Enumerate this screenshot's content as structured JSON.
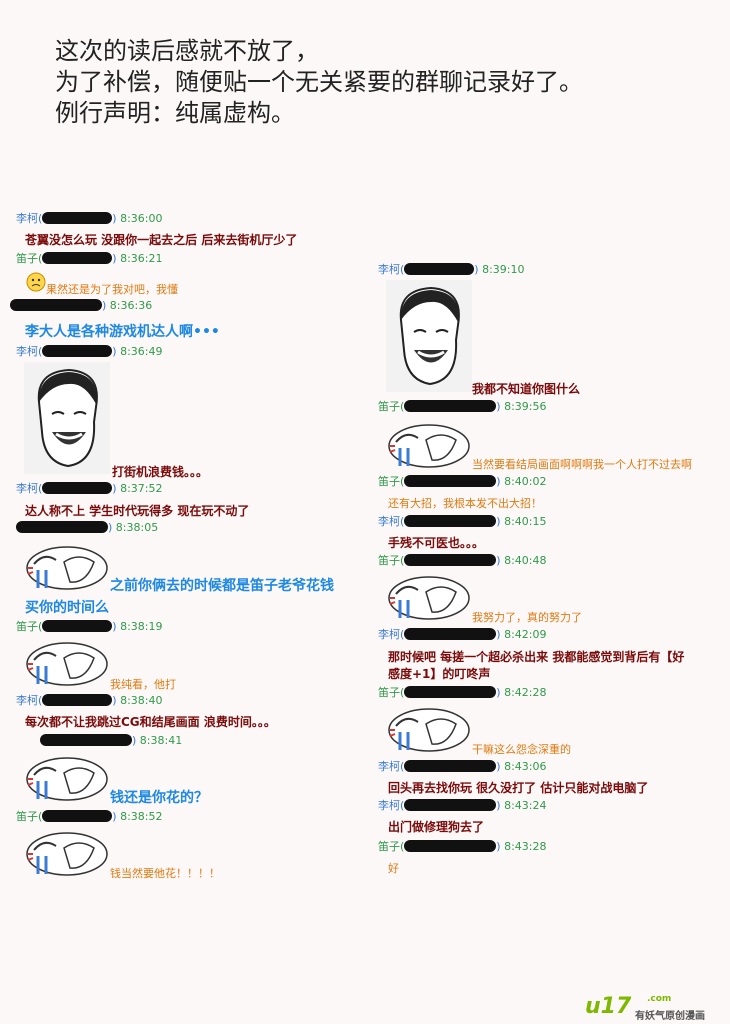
{
  "intro": [
    "这次的读后感就不放了，",
    "为了补偿，随便贴一个无关紧要的群聊记录好了。",
    "例行声明：纯属虚构。"
  ],
  "names": {
    "li": "李柯(",
    "di": "笛子(",
    "close": ")"
  },
  "left": {
    "m1": {
      "time": "8:36:00",
      "text": "苍翼没怎么玩 没跟你一起去之后 后来去街机厅少了"
    },
    "m2": {
      "time": "8:36:21",
      "text": "果然还是为了我对吧，我懂"
    },
    "m3": {
      "time": "8:36:36",
      "text": "李大人是各种游戏机达人啊•••"
    },
    "m4": {
      "time": "8:36:49",
      "text": "打街机浪费钱。。。"
    },
    "m5": {
      "time": "8:37:52",
      "text": "达人称不上 学生时代玩得多 现在玩不动了"
    },
    "m6": {
      "time": "8:38:05",
      "text1": "之前你俩去的时候都是笛子老爷花钱",
      "text2": "买你的时间么"
    },
    "m7": {
      "time": "8:38:19",
      "text": "我纯看，他打"
    },
    "m8": {
      "time": "8:38:40",
      "text": "每次都不让我跳过CG和结尾画面 浪费时间。。。"
    },
    "m9": {
      "time": "8:38:41",
      "text": "钱还是你花的？"
    },
    "m10": {
      "time": "8:38:52",
      "text": "钱当然要他花！！！！"
    }
  },
  "right": {
    "m1": {
      "time": "8:39:10",
      "text": "我都不知道你图什么"
    },
    "m2": {
      "time": "8:39:56",
      "text": "当然要看结局画面啊啊啊我一个人打不过去啊"
    },
    "m3": {
      "time": "8:40:02",
      "text": "还有大招，我根本发不出大招！"
    },
    "m4": {
      "time": "8:40:15",
      "text": "手残不可医也。。。"
    },
    "m5": {
      "time": "8:40:48",
      "text": "我努力了，真的努力了"
    },
    "m6": {
      "time": "8:42:09",
      "text1": "那时候吧 每搓一个超必杀出来 我都能感觉到背后有【好",
      "text2": "感度+1】的叮咚声"
    },
    "m7": {
      "time": "8:42:28",
      "text": "干嘛这么怨念深重的"
    },
    "m8": {
      "time": "8:43:06",
      "text": "回头再去找你玩 很久没打了 估计只能对战电脑了"
    },
    "m9": {
      "time": "8:43:24",
      "text": "出门做修理狗去了"
    },
    "m10": {
      "time": "8:43:28",
      "text": "好"
    }
  },
  "logo": {
    "brand": "u17",
    "domain": ".com",
    "tagline": "有妖气原创漫画"
  }
}
